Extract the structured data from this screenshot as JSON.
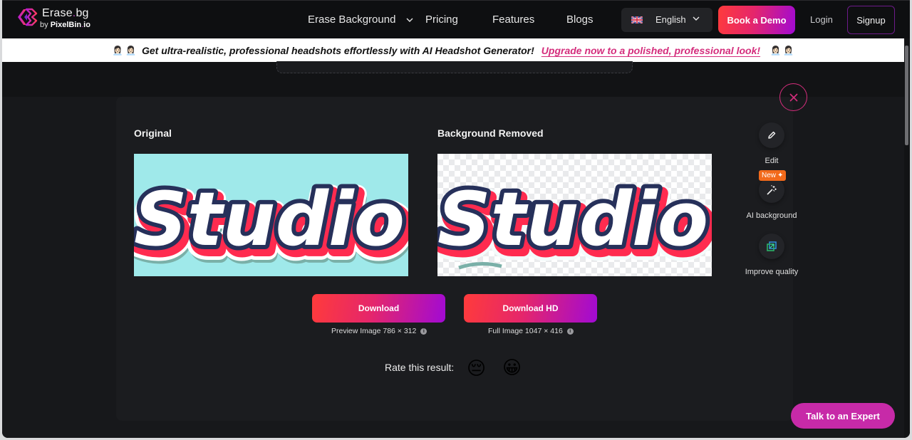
{
  "header": {
    "logo": {
      "title_main": "Erase",
      "title_dot": ".",
      "title_ext": "bg",
      "sub_prefix": "by ",
      "sub_brand": "PixelBin",
      "sub_dot": ".",
      "sub_ext": "io",
      "icon": "erase-bg-logo-icon"
    },
    "nav": [
      {
        "label": "Erase Background",
        "has_dropdown": true
      },
      {
        "label": "Pricing"
      },
      {
        "label": "Features"
      },
      {
        "label": "Blogs"
      }
    ],
    "language": {
      "label": "English",
      "flag": "uk-flag-icon"
    },
    "book_demo_label": "Book a Demo",
    "login_label": "Login",
    "signup_label": "Signup"
  },
  "banner": {
    "emoji_left": "👩🏻‍💼 👩🏻‍💼",
    "message": "Get ultra-realistic, professional headshots effortlessly with AI Headshot Generator!",
    "link_text": "Upgrade now to a polished, professional look!",
    "emoji_right": "👩🏻‍💼 👩🏻‍💼"
  },
  "result": {
    "original_title": "Original",
    "removed_title": "Background Removed",
    "image_text": "Studio",
    "tools": [
      {
        "label": "Edit",
        "icon": "pencil-icon"
      },
      {
        "label": "AI background",
        "icon": "magic-wand-icon",
        "badge": "New"
      },
      {
        "label": "Improve quality",
        "icon": "upscale-icon"
      }
    ],
    "download": {
      "label": "Download",
      "caption": "Preview Image 786 × 312"
    },
    "download_hd": {
      "label": "Download HD",
      "caption": "Full Image 1047 × 416"
    },
    "rate_label": "Rate this result:",
    "rate_options": [
      {
        "emoji": "😔",
        "meaning": "bad"
      },
      {
        "emoji": "😀",
        "meaning": "good"
      }
    ]
  },
  "talk_to_expert_label": "Talk to an Expert",
  "colors": {
    "accent_pink": "#d42d7c",
    "gradient_start": "#ff3b3b",
    "gradient_end": "#a10ad4",
    "badge_orange": "#f26a1b",
    "expert_button": "#c72aa8"
  }
}
